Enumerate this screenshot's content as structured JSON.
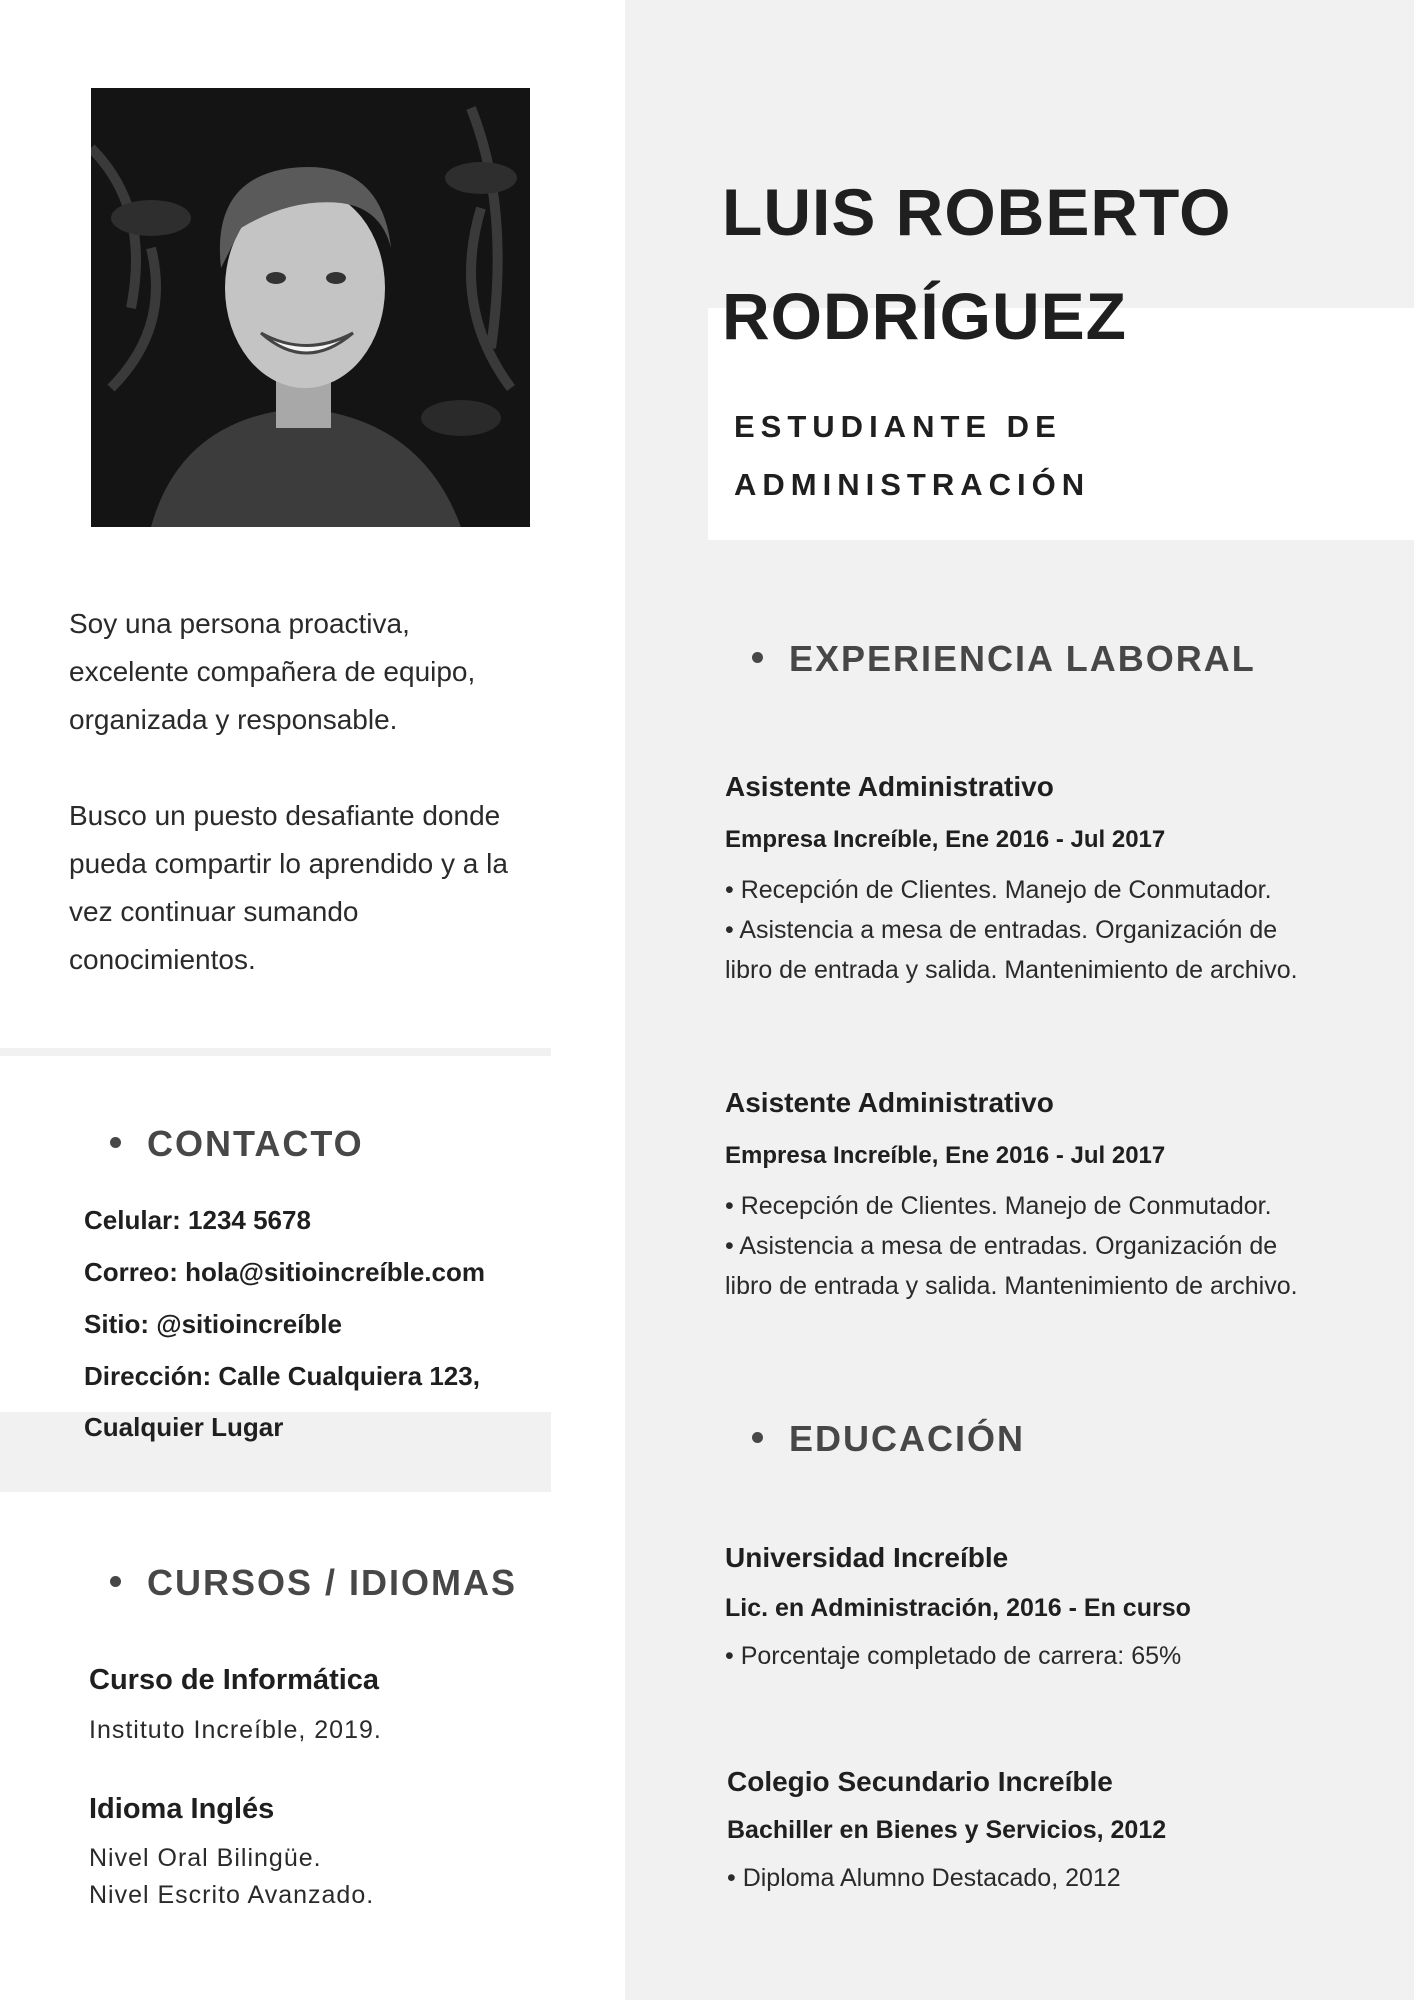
{
  "profile": {
    "name_line1": "LUIS ROBERTO",
    "name_line2": "RODRÍGUEZ",
    "role_line1": "ESTUDIANTE DE",
    "role_line2": "ADMINISTRACIÓN"
  },
  "about": {
    "p1_lines": [
      "Soy una persona proactiva,",
      "excelente compañera de equipo,",
      "organizada y responsable."
    ],
    "p2_lines": [
      "Busco un puesto desafiante donde",
      "pueda compartir lo aprendido y a la",
      "vez continuar sumando",
      "conocimientos."
    ]
  },
  "contact": {
    "title": "CONTACTO",
    "lines": [
      "Celular: 1234 5678",
      "Correo: hola@sitioincreíble.com",
      "Sitio: @sitioincreíble",
      "Dirección: Calle Cualquiera 123,",
      "Cualquier Lugar"
    ]
  },
  "courses": {
    "title": "CURSOS / IDIOMAS",
    "items": [
      {
        "title": "Curso de Informática",
        "lines": [
          "Instituto Increíble, 2019."
        ]
      },
      {
        "title": "Idioma Inglés",
        "lines": [
          "Nivel Oral Bilingüe.",
          "Nivel Escrito Avanzado."
        ]
      }
    ]
  },
  "experience": {
    "title": "EXPERIENCIA LABORAL",
    "items": [
      {
        "title": "Asistente Administrativo",
        "sub": "Empresa Increíble, Ene 2016 - Jul 2017",
        "lines": [
          "• Recepción de Clientes. Manejo de Conmutador.",
          "• Asistencia a mesa de entradas. Organización de",
          "libro de entrada y salida. Mantenimiento de archivo."
        ]
      },
      {
        "title": "Asistente Administrativo",
        "sub": "Empresa Increíble, Ene 2016 - Jul 2017",
        "lines": [
          "• Recepción de Clientes. Manejo de Conmutador.",
          "• Asistencia a mesa de entradas. Organización de",
          "libro de entrada y salida. Mantenimiento de archivo."
        ]
      }
    ]
  },
  "education": {
    "title": "EDUCACIÓN",
    "items": [
      {
        "title": "Universidad Increíble",
        "sub": "Lic. en Administración, 2016 - En curso",
        "lines": [
          "• Porcentaje completado de carrera: 65%"
        ]
      },
      {
        "title": "Colegio Secundario Increíble",
        "sub": "Bachiller en Bienes y Servicios, 2012",
        "lines": [
          "• Diploma Alumno Destacado, 2012"
        ]
      }
    ]
  },
  "colors": {
    "right_panel": "#f1f1f1",
    "text": "#1f1f1f",
    "heading": "#474747"
  }
}
